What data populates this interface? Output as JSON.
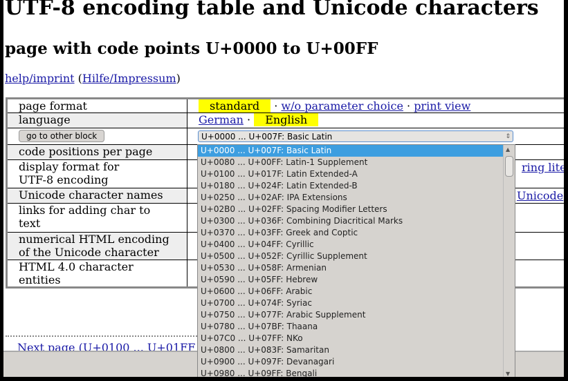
{
  "title": "UTF-8 encoding table and Unicode characters",
  "subtitle": "page with code points U+0000 to U+00FF",
  "help": {
    "link1": "help/imprint",
    "link2": "Hilfe/Impressum"
  },
  "rows": {
    "page_format": {
      "label": "page format",
      "current": "standard",
      "opt1": "w/o parameter choice",
      "opt2": "print view"
    },
    "language": {
      "label": "language",
      "opt1": "German",
      "current": "English"
    },
    "block": {
      "button": "go to other block",
      "selected": "U+0000 ... U+007F: Basic Latin"
    },
    "code_positions": "code positions per page",
    "display_format": {
      "line1": "display format for",
      "line2": "UTF-8 encoding",
      "link_partial": "ring liter"
    },
    "char_names": {
      "label": "Unicode character names",
      "link_partial": "Unicode"
    },
    "links_adding": {
      "line1": "links for adding char to",
      "line2": "text"
    },
    "numerical": {
      "line1": "numerical HTML encoding",
      "line2": "of the Unicode character"
    },
    "entities": {
      "line1": "HTML 4.0 character",
      "line2": "entities"
    }
  },
  "next_page": "Next page (U+0100 ... U+01FF",
  "dropdown_options": [
    "U+0000 ... U+007F: Basic Latin",
    "U+0080 ... U+00FF: Latin-1 Supplement",
    "U+0100 ... U+017F: Latin Extended-A",
    "U+0180 ... U+024F: Latin Extended-B",
    "U+0250 ... U+02AF: IPA Extensions",
    "U+02B0 ... U+02FF: Spacing Modifier Letters",
    "U+0300 ... U+036F: Combining Diacritical Marks",
    "U+0370 ... U+03FF: Greek and Coptic",
    "U+0400 ... U+04FF: Cyrillic",
    "U+0500 ... U+052F: Cyrillic Supplement",
    "U+0530 ... U+058F: Armenian",
    "U+0590 ... U+05FF: Hebrew",
    "U+0600 ... U+06FF: Arabic",
    "U+0700 ... U+074F: Syriac",
    "U+0750 ... U+077F: Arabic Supplement",
    "U+0780 ... U+07BF: Thaana",
    "U+07C0 ... U+07FF: NKo",
    "U+0800 ... U+083F: Samaritan",
    "U+0900 ... U+097F: Devanagari",
    "U+0980 ... U+09FF: Bengali"
  ],
  "colors": {
    "highlight": "#ffff00",
    "selected_option": "#3d9ee0",
    "link": "#1a1aa6"
  }
}
